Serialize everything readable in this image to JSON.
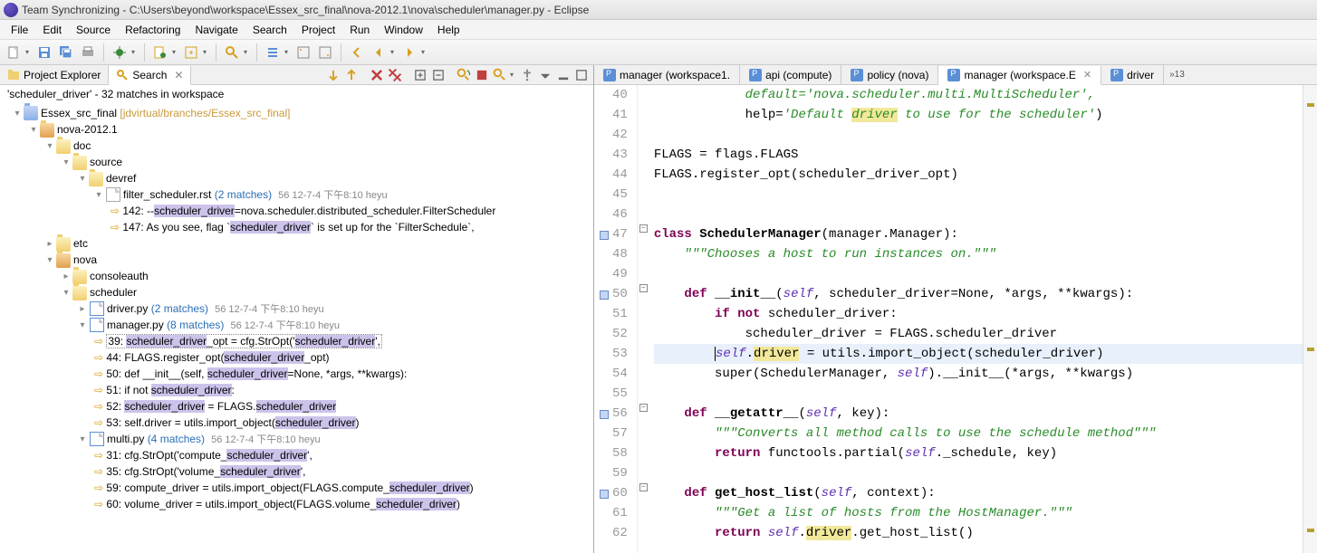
{
  "window": {
    "title": "Team Synchronizing - C:\\Users\\beyond\\workspace\\Essex_src_final\\nova-2012.1\\nova\\scheduler\\manager.py - Eclipse"
  },
  "menu": [
    "File",
    "Edit",
    "Source",
    "Refactoring",
    "Navigate",
    "Search",
    "Project",
    "Run",
    "Window",
    "Help"
  ],
  "left_tabs": {
    "project_explorer": "Project Explorer",
    "search": "Search"
  },
  "search": {
    "summary": "'scheduler_driver' - 32 matches in workspace",
    "root": {
      "label": "Essex_src_final",
      "repo": " [jdvirtual/branches/Essex_src_final]"
    },
    "nova2012": "nova-2012.1",
    "doc": "doc",
    "source": "source",
    "devref": "devref",
    "filter_file": {
      "name": "filter_scheduler.rst",
      "matches": "(2 matches)",
      "meta": "56  12-7-4 下午8:10  heyu"
    },
    "m142": {
      "ln": "142:",
      "pre": " --",
      "hl": "scheduler_driver",
      "post": "=nova.scheduler.distributed_scheduler.FilterScheduler"
    },
    "m147": {
      "ln": "147:",
      "pre": " As you see, flag `",
      "hl": "scheduler_driver",
      "post": "` is set up for the `FilterSchedule`,"
    },
    "etc": "etc",
    "nova": "nova",
    "consoleauth": "consoleauth",
    "scheduler": "scheduler",
    "driverpy": {
      "name": "driver.py",
      "matches": "(2 matches)",
      "meta": "56  12-7-4 下午8:10  heyu"
    },
    "managerpy": {
      "name": "manager.py",
      "matches": "(8 matches)",
      "meta": "56  12-7-4 下午8:10  heyu"
    },
    "m39": {
      "ln": "39:",
      "pre": " ",
      "hl1": "scheduler_driver",
      "mid": "_opt = cfg.StrOpt('",
      "hl2": "scheduler_driver",
      "post": "',"
    },
    "m44": {
      "ln": "44:",
      "pre": " FLAGS.register_opt(",
      "hl": "scheduler_driver",
      "post": "_opt)"
    },
    "m50": {
      "ln": "50:",
      "pre": " def __init__(self, ",
      "hl": "scheduler_driver",
      "post": "=None, *args, **kwargs):"
    },
    "m51": {
      "ln": "51:",
      "pre": " if not ",
      "hl": "scheduler_driver",
      "post": ":"
    },
    "m52": {
      "ln": "52:",
      "pre": " ",
      "hl1": "scheduler_driver",
      "mid": " = FLAGS.",
      "hl2": "scheduler_driver"
    },
    "m53": {
      "ln": "53:",
      "pre": " self.driver = utils.import_object(",
      "hl": "scheduler_driver",
      "post": ")"
    },
    "multipy": {
      "name": "multi.py",
      "matches": "(4 matches)",
      "meta": "56  12-7-4 下午8:10  heyu"
    },
    "m31": {
      "ln": "31:",
      "pre": " cfg.StrOpt('compute_",
      "hl": "scheduler_driver",
      "post": "',"
    },
    "m35": {
      "ln": "35:",
      "pre": " cfg.StrOpt('volume_",
      "hl": "scheduler_driver",
      "post": "',"
    },
    "m59": {
      "ln": "59:",
      "pre": " compute_driver = utils.import_object(FLAGS.compute_",
      "hl": "scheduler_driver",
      "post": ")"
    },
    "m60": {
      "ln": "60:",
      "pre": " volume_driver = utils.import_object(FLAGS.volume_",
      "hl": "scheduler_driver",
      "post": ")"
    }
  },
  "editor_tabs": [
    {
      "label": "manager (workspace1."
    },
    {
      "label": "api (compute)"
    },
    {
      "label": "policy (nova)"
    },
    {
      "label": "manager (workspace.E",
      "active": true
    },
    {
      "label": "driver"
    }
  ],
  "editor_more": "»13",
  "code": {
    "l40": "            default='nova.scheduler.multi.MultiScheduler',",
    "l41a": "            help=",
    "l41b": "'Default ",
    "l41hl": "driver",
    "l41c": " to use for the scheduler'",
    "l41d": ")",
    "l42": "",
    "l43": "FLAGS = flags.FLAGS",
    "l44": "FLAGS.register_opt(scheduler_driver_opt)",
    "l45": "",
    "l46": "",
    "l47a": "class",
    "l47b": " SchedulerManager",
    "l47c": "(manager.Manager):",
    "l48": "    \"\"\"Chooses a host to run instances on.\"\"\"",
    "l49": "",
    "l50a": "    ",
    "l50b": "def",
    "l50c": " __init__",
    "l50d": "(",
    "l50e": "self",
    "l50f": ", scheduler_driver=None, *args, **kwargs):",
    "l51a": "        ",
    "l51b": "if",
    "l51c": " ",
    "l51d": "not",
    "l51e": " scheduler_driver:",
    "l52": "            scheduler_driver = FLAGS.scheduler_driver",
    "l53a": "        ",
    "l53b": "self",
    "l53c": ".",
    "l53hl": "driver",
    "l53d": " = utils.import_object(scheduler_driver)",
    "l54a": "        super(SchedulerManager, ",
    "l54b": "self",
    "l54c": ").__init__(*args, **kwargs)",
    "l55": "",
    "l56a": "    ",
    "l56b": "def",
    "l56c": " __getattr__",
    "l56d": "(",
    "l56e": "self",
    "l56f": ", key):",
    "l57": "        \"\"\"Converts all method calls to use the schedule method\"\"\"",
    "l58a": "        ",
    "l58b": "return",
    "l58c": " functools.partial(",
    "l58d": "self",
    "l58e": "._schedule, key)",
    "l59": "",
    "l60a": "    ",
    "l60b": "def",
    "l60c": " get_host_list",
    "l60d": "(",
    "l60e": "self",
    "l60f": ", context):",
    "l61": "        \"\"\"Get a list of hosts from the HostManager.\"\"\"",
    "l62a": "        ",
    "l62b": "return",
    "l62c": " ",
    "l62d": "self",
    "l62e": ".",
    "l62hl": "driver",
    "l62f": ".get_host_list()"
  },
  "line_numbers": [
    "40",
    "41",
    "42",
    "43",
    "44",
    "45",
    "46",
    "47",
    "48",
    "49",
    "50",
    "51",
    "52",
    "53",
    "54",
    "55",
    "56",
    "57",
    "58",
    "59",
    "60",
    "61",
    "62"
  ]
}
